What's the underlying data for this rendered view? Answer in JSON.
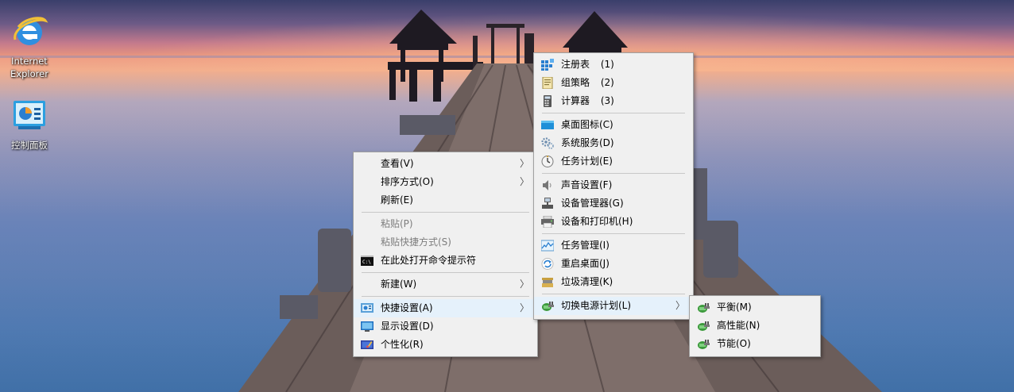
{
  "desktop_icons": [
    {
      "name": "internet-explorer-shortcut",
      "icon": "internet-explorer-icon",
      "label_line1": "Internet",
      "label_line2": "Explorer"
    },
    {
      "name": "control-panel-shortcut",
      "icon": "control-panel-icon",
      "label_line1": "控制面板",
      "label_line2": ""
    }
  ],
  "context_menu": {
    "items": [
      {
        "label": "查看(V)",
        "submenu": true
      },
      {
        "label": "排序方式(O)",
        "submenu": true
      },
      {
        "label": "刷新(E)"
      },
      {
        "label": "粘贴(P)",
        "disabled": true
      },
      {
        "label": "粘贴快捷方式(S)",
        "disabled": true
      },
      {
        "label": "在此处打开命令提示符",
        "icon": "command-prompt-icon"
      },
      {
        "label": "新建(W)",
        "submenu": true
      },
      {
        "label": "快捷设置(A)",
        "icon": "quick-settings-icon",
        "submenu": true,
        "highlighted": true
      },
      {
        "label": "显示设置(D)",
        "icon": "display-icon"
      },
      {
        "label": "个性化(R)",
        "icon": "personalize-icon"
      }
    ]
  },
  "quick_settings_menu": {
    "items": [
      {
        "label": "注册表",
        "shortcut": "(1)",
        "icon": "registry-icon"
      },
      {
        "label": "组策略",
        "shortcut": "(2)",
        "icon": "group-policy-icon"
      },
      {
        "label": "计算器",
        "shortcut": "(3)",
        "icon": "calculator-icon"
      },
      {
        "label": "桌面图标(C)",
        "icon": "desktop-icons-icon"
      },
      {
        "label": "系统服务(D)",
        "icon": "services-gear-icon"
      },
      {
        "label": "任务计划(E)",
        "icon": "clock-icon"
      },
      {
        "label": "声音设置(F)",
        "icon": "speaker-icon"
      },
      {
        "label": "设备管理器(G)",
        "icon": "device-manager-icon"
      },
      {
        "label": "设备和打印机(H)",
        "icon": "printer-icon"
      },
      {
        "label": "任务管理(I)",
        "icon": "task-manager-icon"
      },
      {
        "label": "重启桌面(J)",
        "icon": "refresh-icon"
      },
      {
        "label": "垃圾清理(K)",
        "icon": "cleanup-icon"
      },
      {
        "label": "切换电源计划(L)",
        "icon": "power-plan-icon",
        "submenu": true
      }
    ]
  },
  "power_plan_menu": {
    "items": [
      {
        "label": "平衡(M)",
        "icon": "power-plan-icon"
      },
      {
        "label": "高性能(N)",
        "icon": "power-plan-icon"
      },
      {
        "label": "节能(O)",
        "icon": "power-plan-icon"
      }
    ]
  },
  "submenu_arrow": "〉"
}
